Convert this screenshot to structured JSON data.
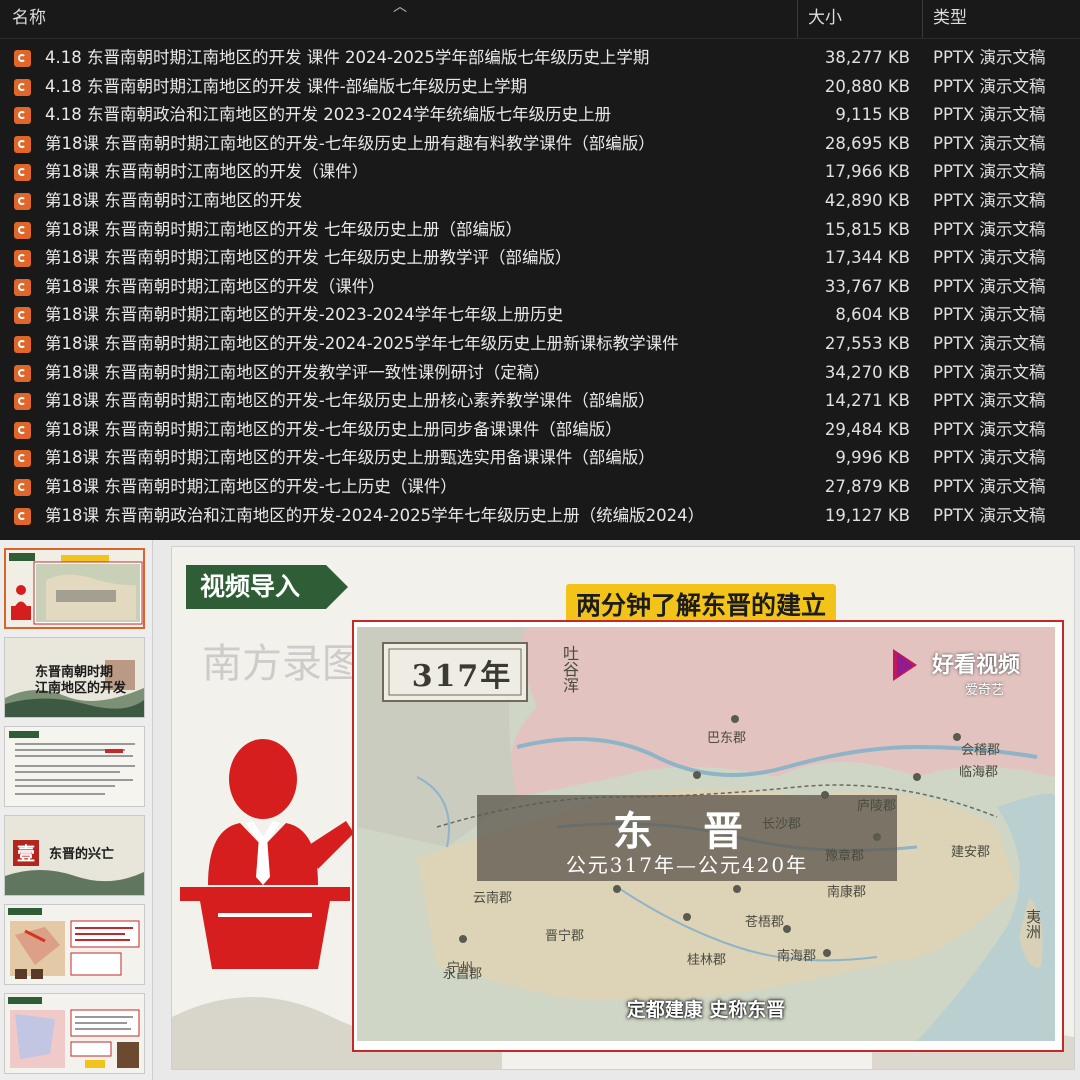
{
  "explorer": {
    "columns": {
      "name": "名称",
      "size": "大小",
      "type": "类型"
    },
    "files": [
      {
        "name": "4.18 东晋南朝时期江南地区的开发 课件 2024-2025学年部编版七年级历史上学期",
        "size": "38,277 KB",
        "type": "PPTX 演示文稿"
      },
      {
        "name": "4.18 东晋南朝时期江南地区的开发 课件-部编版七年级历史上学期",
        "size": "20,880 KB",
        "type": "PPTX 演示文稿"
      },
      {
        "name": "4.18 东晋南朝政治和江南地区的开发 2023-2024学年统编版七年级历史上册",
        "size": "9,115 KB",
        "type": "PPTX 演示文稿"
      },
      {
        "name": "第18课 东晋南朝时期江南地区的开发-七年级历史上册有趣有料教学课件（部编版）",
        "size": "28,695 KB",
        "type": "PPTX 演示文稿"
      },
      {
        "name": "第18课 东晋南朝时江南地区的开发（课件）",
        "size": "17,966 KB",
        "type": "PPTX 演示文稿"
      },
      {
        "name": "第18课 东晋南朝时江南地区的开发",
        "size": "42,890 KB",
        "type": "PPTX 演示文稿"
      },
      {
        "name": "第18课 东晋南朝时期江南地区的开发 七年级历史上册（部编版）",
        "size": "15,815 KB",
        "type": "PPTX 演示文稿"
      },
      {
        "name": "第18课 东晋南朝时期江南地区的开发 七年级历史上册教学评（部编版）",
        "size": "17,344 KB",
        "type": "PPTX 演示文稿"
      },
      {
        "name": "第18课 东晋南朝时期江南地区的开发（课件）",
        "size": "33,767 KB",
        "type": "PPTX 演示文稿"
      },
      {
        "name": "第18课 东晋南朝时期江南地区的开发-2023-2024学年七年级上册历史",
        "size": "8,604 KB",
        "type": "PPTX 演示文稿"
      },
      {
        "name": "第18课 东晋南朝时期江南地区的开发-2024-2025学年七年级历史上册新课标教学课件",
        "size": "27,553 KB",
        "type": "PPTX 演示文稿"
      },
      {
        "name": "第18课 东晋南朝时期江南地区的开发教学评一致性课例研讨（定稿）",
        "size": "34,270 KB",
        "type": "PPTX 演示文稿"
      },
      {
        "name": "第18课 东晋南朝时期江南地区的开发-七年级历史上册核心素养教学课件（部编版）",
        "size": "14,271 KB",
        "type": "PPTX 演示文稿"
      },
      {
        "name": "第18课 东晋南朝时期江南地区的开发-七年级历史上册同步备课课件（部编版）",
        "size": "29,484 KB",
        "type": "PPTX 演示文稿"
      },
      {
        "name": "第18课 东晋南朝时期江南地区的开发-七年级历史上册甄选实用备课课件（部编版）",
        "size": "9,996 KB",
        "type": "PPTX 演示文稿"
      },
      {
        "name": "第18课 东晋南朝时期江南地区的开发-七上历史（课件）",
        "size": "27,879 KB",
        "type": "PPTX 演示文稿"
      },
      {
        "name": "第18课 东晋南朝政治和江南地区的开发-2024-2025学年七年级历史上册（统编版2024）",
        "size": "19,127 KB",
        "type": "PPTX 演示文稿"
      }
    ]
  },
  "slide": {
    "tag": "视频导入",
    "subtitle": "两分钟了解东晋的建立",
    "video": {
      "year": "317年",
      "banner_title": "东  晋",
      "banner_sub": "公元317年—公元420年",
      "caption": "定都建康 史称东晋",
      "logo": "好看视频",
      "logo_sub": "爱奇艺",
      "map_labels": [
        "吐谷浑",
        "巴东郡",
        "庐陵郡",
        "长沙郡",
        "豫章郡",
        "建安郡",
        "临海郡",
        "南康郡",
        "云南郡",
        "晋宁郡",
        "宁州",
        "桂林郡",
        "南海郡",
        "苍梧郡",
        "永昌郡",
        "会稽郡",
        "夷洲"
      ],
      "watermark": "南方录图"
    }
  },
  "thumbnails": {
    "t1": {
      "tag": "视频导入",
      "title": "两分钟了解东晋的建立"
    },
    "t2": {
      "title": "东晋南朝时期江南地区的开发"
    },
    "t4": {
      "num": "壹",
      "title": "东晋的兴亡"
    }
  },
  "colors": {
    "accent": "#d9652b",
    "tag_green": "#2f5e36",
    "subtitle_yellow": "#f2c318",
    "frame_red": "#c62828",
    "figure_red": "#d71e1e"
  }
}
